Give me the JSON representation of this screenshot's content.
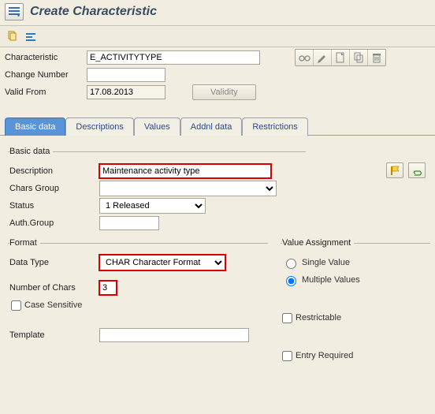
{
  "header": {
    "title": "Create Characteristic"
  },
  "toolstrip": {},
  "form": {
    "characteristic_label": "Characteristic",
    "characteristic_value": "E_ACTIVITYTYPE",
    "change_number_label": "Change Number",
    "change_number_value": "",
    "valid_from_label": "Valid From",
    "valid_from_value": "17.08.2013",
    "validity_btn": "Validity"
  },
  "tabs": [
    "Basic data",
    "Descriptions",
    "Values",
    "Addnl data",
    "Restrictions"
  ],
  "basic": {
    "legend": "Basic data",
    "description_label": "Description",
    "description_value": "Maintenance activity type",
    "chars_group_label": "Chars Group",
    "chars_group_value": "",
    "status_label": "Status",
    "status_value": "1 Released",
    "auth_group_label": "Auth.Group",
    "auth_group_value": ""
  },
  "format": {
    "legend": "Format",
    "data_type_label": "Data Type",
    "data_type_value": "CHAR Character Format",
    "num_chars_label": "Number of Chars",
    "num_chars_value": "3",
    "case_sensitive_label": "Case Sensitive",
    "template_label": "Template",
    "template_value": ""
  },
  "value_assignment": {
    "legend": "Value Assignment",
    "single_label": "Single Value",
    "multiple_label": "Multiple Values",
    "restrictable_label": "Restrictable",
    "entry_required_label": "Entry Required"
  }
}
